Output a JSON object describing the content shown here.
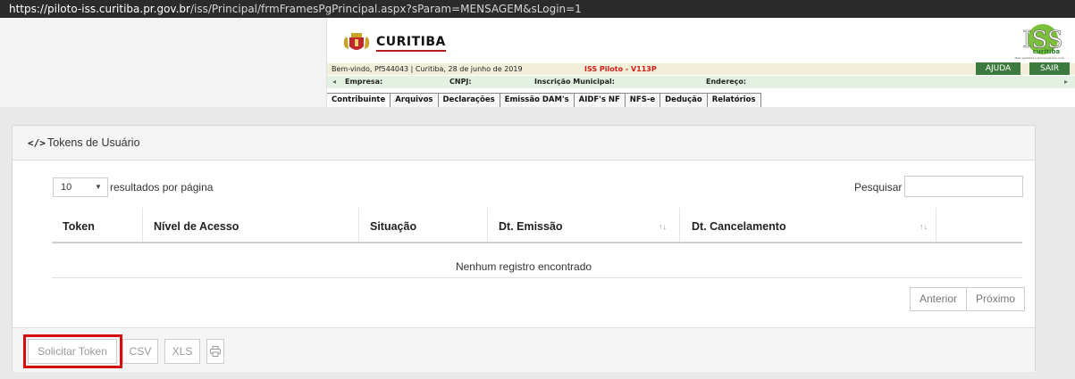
{
  "browser": {
    "url_host": "https://piloto-iss.curitiba.pr.gov.br",
    "url_path": "/iss/Principal/frmFramesPgPrincipal.aspx?sParam=MENSAGEM&sLogin=1"
  },
  "header": {
    "logo_text": "CURITIBA",
    "welcome_text": "Bem-vindo, Pf544043 | Curitiba, 28 de junho de 2019",
    "version_text": "ISS Piloto - V113P",
    "help_label": "AJUDA",
    "exit_label": "SAIR",
    "iss_logo": {
      "big": "ISS",
      "small": "curitiba",
      "tagline": "Mais agilidade e tecnologia pra você"
    },
    "company_label": "Empresa:",
    "cnpj_label": "CNPJ:",
    "municipal_label": "Inscrição Municipal:",
    "address_label": "Endereço:",
    "menu": [
      "Contribuinte",
      "Arquivos",
      "Declarações",
      "Emissão DAM's",
      "AIDF's NF",
      "NFS-e",
      "Dedução",
      "Relatórios"
    ]
  },
  "panel": {
    "title": "Tokens de Usuário",
    "page_length_value": "10",
    "page_length_label": "resultados por página",
    "search_label": "Pesquisar",
    "columns": [
      "Token",
      "Nível de Acesso",
      "Situação",
      "Dt. Emissão",
      "Dt. Cancelamento"
    ],
    "empty_text": "Nenhum registro encontrado",
    "pager": {
      "prev": "Anterior",
      "next": "Próximo"
    },
    "footer_buttons": {
      "request_token": "Solicitar Token",
      "csv": "CSV",
      "xls": "XLS"
    }
  },
  "colors": {
    "highlight": "#d40e0e",
    "header_green": "#3d7a3d",
    "version_red": "#d31b1b"
  }
}
